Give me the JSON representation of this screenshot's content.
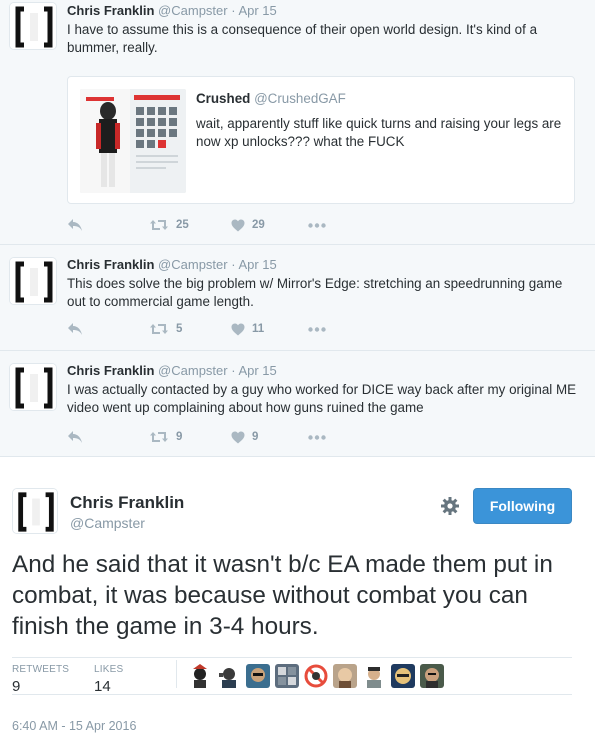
{
  "tweets": [
    {
      "fullname": "Chris Franklin",
      "handle": "@Campster",
      "dot": "·",
      "time": "Apr 15",
      "text": "I have to assume this is a consequence of their open world design. It's kind of a bummer, really.",
      "quote": {
        "fullname": "Crushed",
        "handle": "@CrushedGAF",
        "text": "wait, apparently stuff like quick turns and raising your legs are now xp unlocks??? what the FUCK"
      },
      "retweets": "25",
      "likes": "29"
    },
    {
      "fullname": "Chris Franklin",
      "handle": "@Campster",
      "dot": "·",
      "time": "Apr 15",
      "text": "This does solve the big problem w/ Mirror's Edge: stretching an speedrunning game out to commercial game length.",
      "retweets": "5",
      "likes": "11"
    },
    {
      "fullname": "Chris Franklin",
      "handle": "@Campster",
      "dot": "·",
      "time": "Apr 15",
      "text": "I was actually contacted by a guy who worked for DICE way back after my original ME video went up complaining about how guns ruined the game",
      "retweets": "9",
      "likes": "9"
    }
  ],
  "main": {
    "fullname": "Chris Franklin",
    "handle": "@Campster",
    "follow_label": "Following",
    "text": "And he said that it wasn't b/c EA made them put in combat, it was because without combat you can finish the game in 3-4 hours.",
    "retweets_label": "RETWEETS",
    "retweets_value": "9",
    "likes_label": "LIKES",
    "likes_value": "14",
    "timestamp": "6:40 AM - 15 Apr 2016"
  },
  "colors": {
    "accent": "#3b94d9",
    "muted": "#8899a6",
    "action_icon": "#aab8c2",
    "conversation_bg": "#f5f8fa"
  },
  "icons": [
    "reply-icon",
    "retweet-icon",
    "heart-icon",
    "more-icon",
    "gear-icon"
  ]
}
